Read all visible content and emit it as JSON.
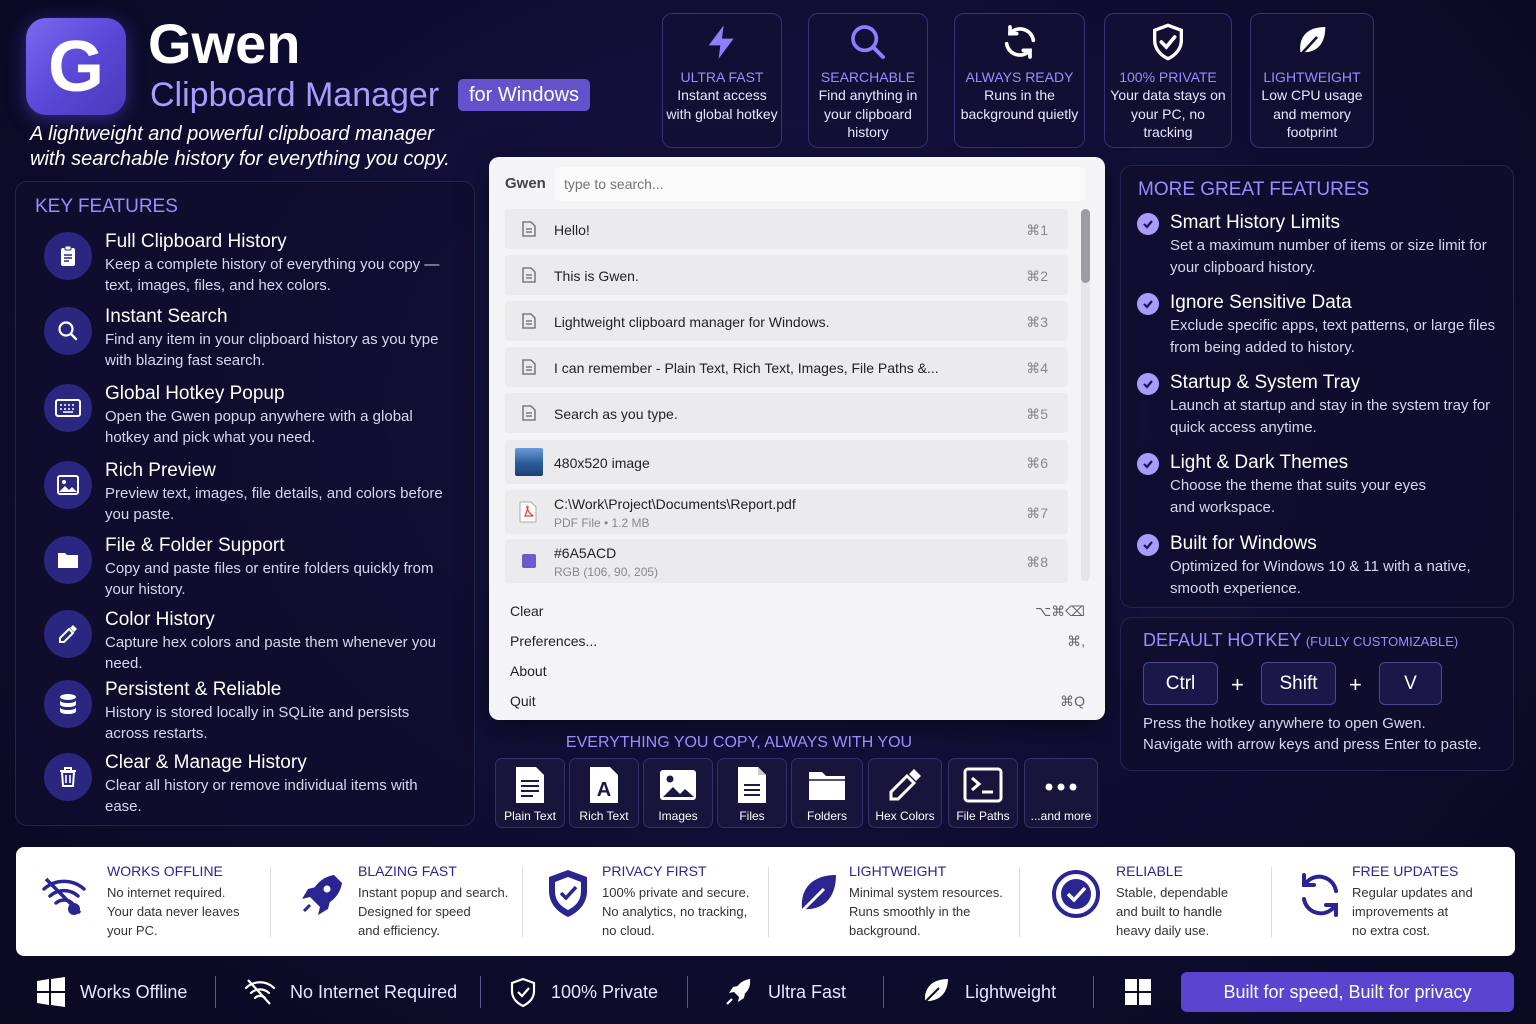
{
  "colors": {
    "accent": "#9d8cff",
    "brand": "#6252cc",
    "background": "#0c0c2a",
    "popup": "#f4f4f7",
    "cta": "#5b44d0"
  },
  "header": {
    "logo_letter": "G",
    "app_name": "Gwen",
    "subtitle": "Clipboard Manager",
    "platform_badge": "for Windows",
    "tagline": "A lightweight and powerful clipboard manager with searchable history for everything you copy."
  },
  "top_features": [
    {
      "icon": "lightning-icon",
      "title": "ULTRA FAST",
      "desc": "Instant access with global hotkey"
    },
    {
      "icon": "search-icon",
      "title": "SEARCHABLE",
      "desc": "Find anything in your clipboard history"
    },
    {
      "icon": "refresh-icon",
      "title": "ALWAYS READY",
      "desc": "Runs in the background quietly"
    },
    {
      "icon": "shield-check-icon",
      "title": "100% PRIVATE",
      "desc": "Your data stays on your PC, no tracking"
    },
    {
      "icon": "leaf-icon",
      "title": "LIGHTWEIGHT",
      "desc": "Low CPU usage and memory footprint"
    }
  ],
  "key_features": {
    "heading": "KEY FEATURES",
    "items": [
      {
        "icon": "clipboard-icon",
        "title": "Full Clipboard History",
        "desc": "Keep a complete history of everything you copy — text, images, files, and hex colors."
      },
      {
        "icon": "search-icon",
        "title": "Instant Search",
        "desc": "Find any item in your clipboard history as you type with blazing fast search."
      },
      {
        "icon": "keyboard-icon",
        "title": "Global Hotkey Popup",
        "desc": "Open the Gwen popup anywhere with a global hotkey and pick what you need."
      },
      {
        "icon": "image-icon",
        "title": "Rich Preview",
        "desc": "Preview text, images, file details, and colors before you paste."
      },
      {
        "icon": "folder-icon",
        "title": "File & Folder Support",
        "desc": "Copy and paste files or entire folders quickly from your history."
      },
      {
        "icon": "eyedropper-icon",
        "title": "Color History",
        "desc": "Capture hex colors and paste them whenever you need."
      },
      {
        "icon": "database-icon",
        "title": "Persistent & Reliable",
        "desc": "History is stored locally in SQLite and persists across restarts."
      },
      {
        "icon": "trash-icon",
        "title": "Clear & Manage History",
        "desc": "Clear all history or remove individual items with ease."
      }
    ]
  },
  "popup": {
    "label": "Gwen",
    "search_placeholder": "type to search...",
    "search_value": "",
    "items": [
      {
        "icon": "text-doc-icon",
        "text": "Hello!",
        "sub": "",
        "shortcut": "⌘1"
      },
      {
        "icon": "text-doc-icon",
        "text": "This is Gwen.",
        "sub": "",
        "shortcut": "⌘2"
      },
      {
        "icon": "text-doc-icon",
        "text": "Lightweight clipboard manager for Windows.",
        "sub": "",
        "shortcut": "⌘3"
      },
      {
        "icon": "text-doc-icon",
        "text": "I can remember - Plain Text, Rich Text, Images, File Paths &...",
        "sub": "",
        "shortcut": "⌘4"
      },
      {
        "icon": "text-doc-icon",
        "text": "Search as you type.",
        "sub": "",
        "shortcut": "⌘5"
      },
      {
        "icon": "image-thumbnail-icon",
        "text": "480x520 image",
        "sub": "",
        "shortcut": "⌘6"
      },
      {
        "icon": "pdf-file-icon",
        "text": "C:\\Work\\Project\\Documents\\Report.pdf",
        "sub": "PDF File • 1.2 MB",
        "shortcut": "⌘7"
      },
      {
        "icon": "color-swatch-icon",
        "text": "#6A5ACD",
        "sub": "RGB (106, 90, 205)",
        "shortcut": "⌘8",
        "swatch": "#6A5ACD"
      }
    ],
    "menu": [
      {
        "label": "Clear",
        "shortcut": "⌥⌘⌫"
      },
      {
        "label": "Preferences...",
        "shortcut": "⌘,"
      },
      {
        "label": "About",
        "shortcut": ""
      },
      {
        "label": "Quit",
        "shortcut": "⌘Q"
      }
    ]
  },
  "types": {
    "heading": "EVERYTHING YOU COPY, ALWAYS WITH YOU",
    "items": [
      {
        "icon": "plain-text-icon",
        "label": "Plain Text"
      },
      {
        "icon": "rich-text-icon",
        "label": "Rich Text"
      },
      {
        "icon": "image-icon",
        "label": "Images"
      },
      {
        "icon": "file-icon",
        "label": "Files"
      },
      {
        "icon": "folder-icon",
        "label": "Folders"
      },
      {
        "icon": "eyedropper-icon",
        "label": "Hex Colors"
      },
      {
        "icon": "terminal-icon",
        "label": "File Paths"
      },
      {
        "icon": "more-icon",
        "label": "...and more"
      }
    ]
  },
  "more_features": {
    "heading": "MORE GREAT FEATURES",
    "items": [
      {
        "title": "Smart History Limits",
        "desc": "Set a maximum number of items or size limit for your clipboard history."
      },
      {
        "title": "Ignore Sensitive Data",
        "desc": "Exclude specific apps, text patterns, or large files from being added to history."
      },
      {
        "title": "Startup & System Tray",
        "desc": "Launch at startup and stay in the system tray for quick access anytime."
      },
      {
        "title": "Light & Dark Themes",
        "desc": "Choose the theme that suits your eyes and workspace."
      },
      {
        "title": "Built for Windows",
        "desc": "Optimized for Windows 10 & 11 with a native, smooth experience."
      }
    ]
  },
  "hotkey": {
    "heading": "DEFAULT HOTKEY",
    "heading_note": "(FULLY CUSTOMIZABLE)",
    "keys": [
      "Ctrl",
      "Shift",
      "V"
    ],
    "plus": "+",
    "desc1": "Press the hotkey anywhere to open Gwen.",
    "desc2": "Navigate with arrow keys and press Enter to paste."
  },
  "benefits": [
    {
      "icon": "wifi-off-icon",
      "title": "WORKS OFFLINE",
      "lines": [
        "No internet required.",
        "Your data never leaves",
        "your PC."
      ]
    },
    {
      "icon": "rocket-icon",
      "title": "BLAZING FAST",
      "lines": [
        "Instant popup and search.",
        "Designed for speed",
        "and efficiency."
      ]
    },
    {
      "icon": "shield-icon",
      "title": "PRIVACY FIRST",
      "lines": [
        "100% private and secure.",
        "No analytics, no tracking,",
        "no cloud."
      ]
    },
    {
      "icon": "leaf-icon",
      "title": "LIGHTWEIGHT",
      "lines": [
        "Minimal system resources.",
        "Runs smoothly in the",
        "background."
      ]
    },
    {
      "icon": "check-circle-icon",
      "title": "RELIABLE",
      "lines": [
        "Stable, dependable",
        "and built to handle",
        "heavy daily use."
      ]
    },
    {
      "icon": "refresh-icon",
      "title": "FREE UPDATES",
      "lines": [
        "Regular updates and",
        "improvements at",
        "no extra cost."
      ]
    }
  ],
  "footer": {
    "items": [
      {
        "icon": "windows-icon",
        "label": "Works Offline"
      },
      {
        "icon": "wifi-off-icon",
        "label": "No Internet Required"
      },
      {
        "icon": "shield-check-icon",
        "label": "100% Private"
      },
      {
        "icon": "rocket-icon",
        "label": "Ultra Fast"
      },
      {
        "icon": "leaf-icon",
        "label": "Lightweight"
      },
      {
        "icon": "windows-icon",
        "label": ""
      }
    ],
    "cta": "Built for speed, Built for privacy"
  }
}
